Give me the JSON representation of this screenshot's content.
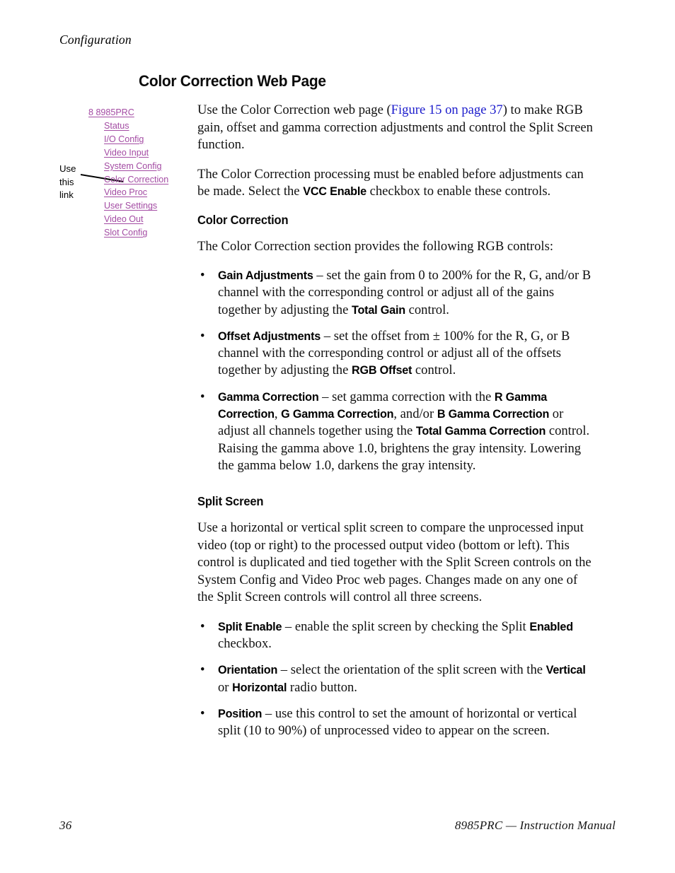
{
  "header": {
    "running_head": "Configuration"
  },
  "title": "Color Correction Web Page",
  "nav_graphic": {
    "callout": {
      "line1": "Use",
      "line2": "this",
      "line3": "link"
    },
    "links": [
      {
        "label": "8 8985PRC",
        "level": "root"
      },
      {
        "label": "Status",
        "level": "indent"
      },
      {
        "label": "I/O Config",
        "level": "indent"
      },
      {
        "label": "Video Input",
        "level": "indent"
      },
      {
        "label": "System Config",
        "level": "indent"
      },
      {
        "label": "Color Correction",
        "level": "indent"
      },
      {
        "label": "Video Proc",
        "level": "indent"
      },
      {
        "label": "User Settings",
        "level": "indent"
      },
      {
        "label": "Video Out",
        "level": "indent"
      },
      {
        "label": "Slot Config",
        "level": "indent"
      }
    ],
    "link_color": "#a34ba3"
  },
  "intro": {
    "para1_before": "Use the Color Correction web page (",
    "para1_xref": "Figure 15 on page 37",
    "para1_after": ") to make RGB gain, offset and gamma correction adjustments and control the Split Screen function.",
    "para2_before": "The Color Correction processing must be enabled before adjustments can be made. Select the ",
    "para2_ui": "VCC Enable",
    "para2_after": " checkbox to enable these controls."
  },
  "color_correction": {
    "heading": "Color Correction",
    "lead": "The Color Correction section provides the following RGB controls:",
    "bullets": [
      {
        "term": "Gain Adjustments",
        "text_1": " – set the gain from 0 to 200% for the R, G, and/or B channel with the corresponding control or adjust all of the gains together by adjusting the ",
        "ui_1": "Total Gain",
        "text_2": " control."
      },
      {
        "term": "Offset Adjustments",
        "text_1": " – set the offset from ± 100% for the R, G, or B channel with the corresponding control or adjust all of the offsets together by adjusting the ",
        "ui_1": "RGB Offset",
        "text_2": " control."
      },
      {
        "term": "Gamma Correction",
        "text_1": " – set gamma correction with the ",
        "ui_1": "R Gamma Correction",
        "text_2": ", ",
        "ui_2": "G Gamma Correction",
        "text_3": ", and/or ",
        "ui_3": "B Gamma Correction",
        "text_4": " or adjust all channels together using the ",
        "ui_4": "Total Gamma Correction",
        "text_5": " control. Raising the gamma above 1.0, brightens the gray intensity. Lowering the gamma below 1.0, darkens the gray intensity."
      }
    ]
  },
  "split_screen": {
    "heading": "Split Screen",
    "lead": "Use a horizontal or vertical split screen to compare the unprocessed input video (top or right) to the processed output video (bottom or left). This control is duplicated and tied together with the Split Screen controls on the System Config and Video Proc web pages. Changes made on any one of the Split Screen controls will control all three screens.",
    "bullets": [
      {
        "term": "Split Enable",
        "text_1": " – enable the split screen by checking the Split ",
        "ui_1": "Enabled",
        "text_2": " checkbox."
      },
      {
        "term": "Orientation",
        "text_1": " – select the orientation of the split screen with the ",
        "ui_1": "Vertical",
        "text_2": " or ",
        "ui_2": "Horizontal",
        "text_3": " radio button."
      },
      {
        "term": "Position",
        "text_1": " – use this control to set the amount of horizontal or vertical split (10 to 90%) of unprocessed video to appear on the screen."
      }
    ]
  },
  "footer": {
    "page_number": "36",
    "manual_title": "8985PRC — Instruction Manual"
  },
  "bullet_glyph": "•"
}
